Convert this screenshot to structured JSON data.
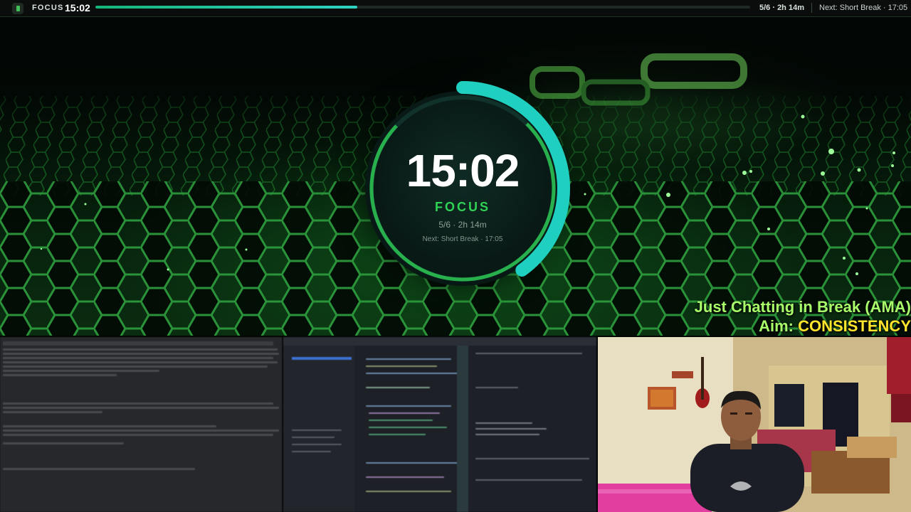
{
  "topbar": {
    "mode": "FOCUS",
    "time": "15:02",
    "progress": 0.4,
    "session": "5/6 · 2h 14m",
    "next": "Next: Short Break · 17:05"
  },
  "timer": {
    "time": "15:02",
    "mode": "FOCUS",
    "session": "5/6 · 2h 14m",
    "next": "Next: Short Break · 17:05",
    "progress": 0.4
  },
  "captions": {
    "line1": "Just Chatting in Break (AMA)",
    "line2_label": "Aim: ",
    "line2_value": "CONSISTENCY"
  },
  "colors": {
    "accent_green": "#2fd255",
    "accent_teal": "#1fcfbf",
    "caption_green": "#a8ff6a",
    "caption_yellow": "#ffe52b"
  },
  "icons": {
    "app": "timer-app-icon"
  }
}
